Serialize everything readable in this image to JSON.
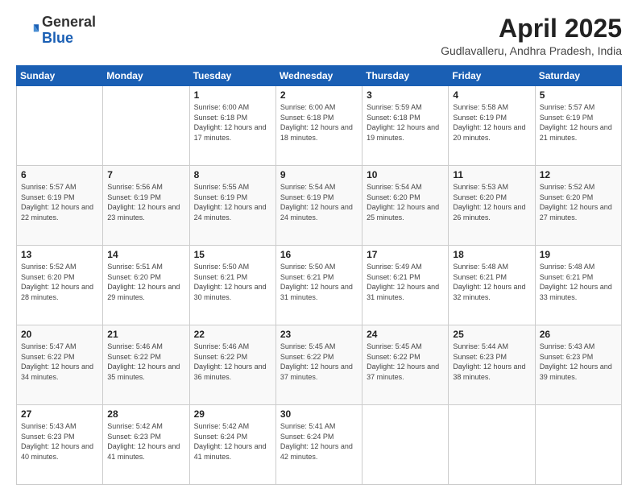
{
  "header": {
    "logo_general": "General",
    "logo_blue": "Blue",
    "title": "April 2025",
    "subtitle": "Gudlavalleru, Andhra Pradesh, India"
  },
  "weekdays": [
    "Sunday",
    "Monday",
    "Tuesday",
    "Wednesday",
    "Thursday",
    "Friday",
    "Saturday"
  ],
  "weeks": [
    [
      {
        "num": "",
        "info": ""
      },
      {
        "num": "",
        "info": ""
      },
      {
        "num": "1",
        "info": "Sunrise: 6:00 AM\nSunset: 6:18 PM\nDaylight: 12 hours and 17 minutes."
      },
      {
        "num": "2",
        "info": "Sunrise: 6:00 AM\nSunset: 6:18 PM\nDaylight: 12 hours and 18 minutes."
      },
      {
        "num": "3",
        "info": "Sunrise: 5:59 AM\nSunset: 6:18 PM\nDaylight: 12 hours and 19 minutes."
      },
      {
        "num": "4",
        "info": "Sunrise: 5:58 AM\nSunset: 6:19 PM\nDaylight: 12 hours and 20 minutes."
      },
      {
        "num": "5",
        "info": "Sunrise: 5:57 AM\nSunset: 6:19 PM\nDaylight: 12 hours and 21 minutes."
      }
    ],
    [
      {
        "num": "6",
        "info": "Sunrise: 5:57 AM\nSunset: 6:19 PM\nDaylight: 12 hours and 22 minutes."
      },
      {
        "num": "7",
        "info": "Sunrise: 5:56 AM\nSunset: 6:19 PM\nDaylight: 12 hours and 23 minutes."
      },
      {
        "num": "8",
        "info": "Sunrise: 5:55 AM\nSunset: 6:19 PM\nDaylight: 12 hours and 24 minutes."
      },
      {
        "num": "9",
        "info": "Sunrise: 5:54 AM\nSunset: 6:19 PM\nDaylight: 12 hours and 24 minutes."
      },
      {
        "num": "10",
        "info": "Sunrise: 5:54 AM\nSunset: 6:20 PM\nDaylight: 12 hours and 25 minutes."
      },
      {
        "num": "11",
        "info": "Sunrise: 5:53 AM\nSunset: 6:20 PM\nDaylight: 12 hours and 26 minutes."
      },
      {
        "num": "12",
        "info": "Sunrise: 5:52 AM\nSunset: 6:20 PM\nDaylight: 12 hours and 27 minutes."
      }
    ],
    [
      {
        "num": "13",
        "info": "Sunrise: 5:52 AM\nSunset: 6:20 PM\nDaylight: 12 hours and 28 minutes."
      },
      {
        "num": "14",
        "info": "Sunrise: 5:51 AM\nSunset: 6:20 PM\nDaylight: 12 hours and 29 minutes."
      },
      {
        "num": "15",
        "info": "Sunrise: 5:50 AM\nSunset: 6:21 PM\nDaylight: 12 hours and 30 minutes."
      },
      {
        "num": "16",
        "info": "Sunrise: 5:50 AM\nSunset: 6:21 PM\nDaylight: 12 hours and 31 minutes."
      },
      {
        "num": "17",
        "info": "Sunrise: 5:49 AM\nSunset: 6:21 PM\nDaylight: 12 hours and 31 minutes."
      },
      {
        "num": "18",
        "info": "Sunrise: 5:48 AM\nSunset: 6:21 PM\nDaylight: 12 hours and 32 minutes."
      },
      {
        "num": "19",
        "info": "Sunrise: 5:48 AM\nSunset: 6:21 PM\nDaylight: 12 hours and 33 minutes."
      }
    ],
    [
      {
        "num": "20",
        "info": "Sunrise: 5:47 AM\nSunset: 6:22 PM\nDaylight: 12 hours and 34 minutes."
      },
      {
        "num": "21",
        "info": "Sunrise: 5:46 AM\nSunset: 6:22 PM\nDaylight: 12 hours and 35 minutes."
      },
      {
        "num": "22",
        "info": "Sunrise: 5:46 AM\nSunset: 6:22 PM\nDaylight: 12 hours and 36 minutes."
      },
      {
        "num": "23",
        "info": "Sunrise: 5:45 AM\nSunset: 6:22 PM\nDaylight: 12 hours and 37 minutes."
      },
      {
        "num": "24",
        "info": "Sunrise: 5:45 AM\nSunset: 6:22 PM\nDaylight: 12 hours and 37 minutes."
      },
      {
        "num": "25",
        "info": "Sunrise: 5:44 AM\nSunset: 6:23 PM\nDaylight: 12 hours and 38 minutes."
      },
      {
        "num": "26",
        "info": "Sunrise: 5:43 AM\nSunset: 6:23 PM\nDaylight: 12 hours and 39 minutes."
      }
    ],
    [
      {
        "num": "27",
        "info": "Sunrise: 5:43 AM\nSunset: 6:23 PM\nDaylight: 12 hours and 40 minutes."
      },
      {
        "num": "28",
        "info": "Sunrise: 5:42 AM\nSunset: 6:23 PM\nDaylight: 12 hours and 41 minutes."
      },
      {
        "num": "29",
        "info": "Sunrise: 5:42 AM\nSunset: 6:24 PM\nDaylight: 12 hours and 41 minutes."
      },
      {
        "num": "30",
        "info": "Sunrise: 5:41 AM\nSunset: 6:24 PM\nDaylight: 12 hours and 42 minutes."
      },
      {
        "num": "",
        "info": ""
      },
      {
        "num": "",
        "info": ""
      },
      {
        "num": "",
        "info": ""
      }
    ]
  ]
}
